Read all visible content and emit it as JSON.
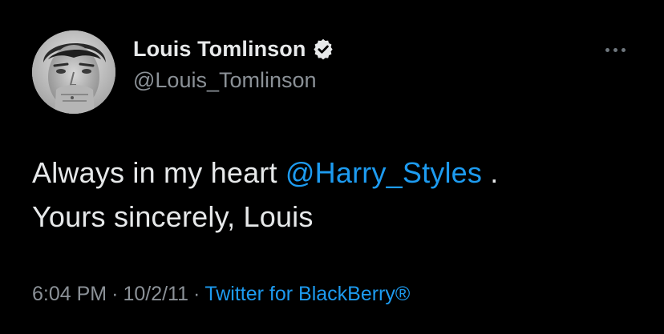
{
  "tweet": {
    "display_name": "Louis Tomlinson",
    "handle": "@Louis_Tomlinson",
    "text_before": "Always in my heart ",
    "mention": "@Harry_Styles",
    "text_after": " .",
    "line2": "Yours sincerely, Louis",
    "time": "6:04 PM",
    "separator": "·",
    "date": "10/2/11",
    "source": "Twitter for BlackBerry®"
  },
  "icons": {
    "verified": "verified-badge-icon",
    "more": "more-horizontal-icon"
  },
  "colors": {
    "background": "#000000",
    "primary_text": "#e7e9ea",
    "secondary_text": "#8b9197",
    "link": "#1d9bf0"
  }
}
